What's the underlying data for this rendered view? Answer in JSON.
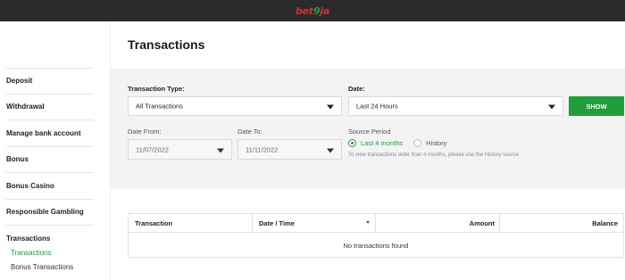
{
  "header": {
    "logo": {
      "part1": "bet",
      "part2": "9",
      "part3": "ja"
    }
  },
  "sidebar": {
    "items": [
      {
        "label": "Deposit"
      },
      {
        "label": "Withdrawal"
      },
      {
        "label": "Manage bank account"
      },
      {
        "label": "Bonus"
      },
      {
        "label": "Bonus Casino"
      },
      {
        "label": "Responsible Gambling"
      },
      {
        "label": "Transactions"
      }
    ],
    "subitems": [
      {
        "label": "Transactions",
        "active": true
      },
      {
        "label": "Bonus Transactions",
        "active": false
      }
    ]
  },
  "page": {
    "title": "Transactions"
  },
  "filters": {
    "transaction_type": {
      "label": "Transaction Type:",
      "value": "All Transactions"
    },
    "date": {
      "label": "Date:",
      "value": "Last 24 Hours"
    },
    "show_button": "SHOW",
    "date_from": {
      "label": "Date From:",
      "value": "11/07/2022"
    },
    "date_to": {
      "label": "Date To:",
      "value": "11/11/2022"
    },
    "source_period": {
      "label": "Source Period",
      "options": [
        {
          "label": "Last 4 months",
          "selected": true
        },
        {
          "label": "History",
          "selected": false
        }
      ],
      "hint": "To view transactions older than 4 months, please use the History source"
    }
  },
  "table": {
    "columns": [
      "Transaction",
      "Date / Time",
      "Amount",
      "Balance"
    ],
    "empty_message": "No transactions found"
  },
  "colors": {
    "accent": "#1f9e3a",
    "logo_red": "#e32a2a",
    "topbar": "#2b2b2b"
  }
}
